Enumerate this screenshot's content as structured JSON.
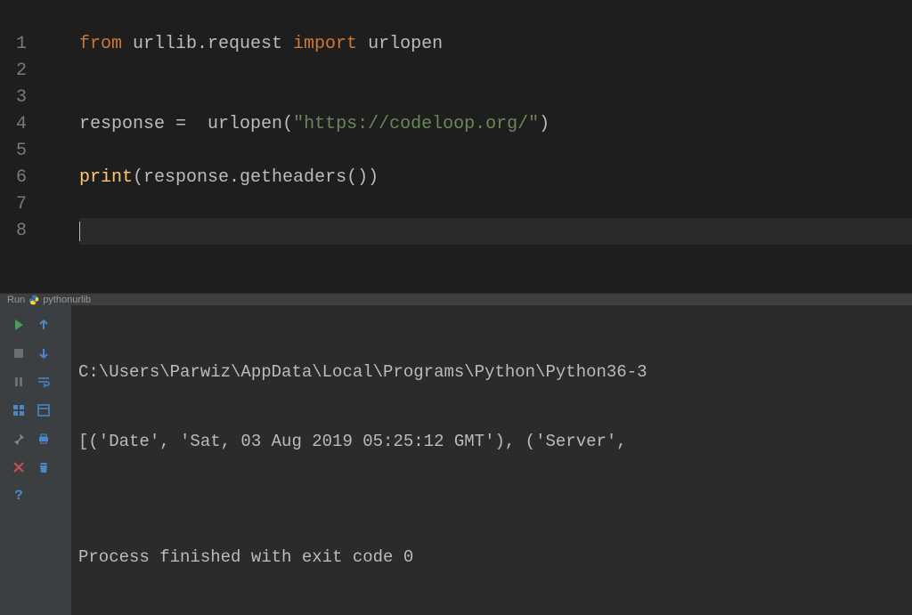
{
  "gutter": {
    "lines": [
      "1",
      "2",
      "3",
      "4",
      "5",
      "6",
      "7",
      "8"
    ]
  },
  "code": {
    "line1": {
      "from": "from ",
      "mod": "urllib.request ",
      "import": "import ",
      "name": "urlopen"
    },
    "line4": {
      "var": "response ",
      "eq": "=  ",
      "fn": "urlopen",
      "open": "(",
      "str": "\"https://codeloop.org/\"",
      "close": ")"
    },
    "line6": {
      "print": "print",
      "open": "(",
      "arg": "response.getheaders()",
      "close": ")"
    }
  },
  "panelHeader": {
    "run": "Run",
    "name": "pythonurlib"
  },
  "console": {
    "line1": "C:\\Users\\Parwiz\\AppData\\Local\\Programs\\Python\\Python36-3",
    "line2": "[('Date', 'Sat, 03 Aug 2019 05:25:12 GMT'), ('Server',",
    "line3": "",
    "line4": "Process finished with exit code 0"
  }
}
